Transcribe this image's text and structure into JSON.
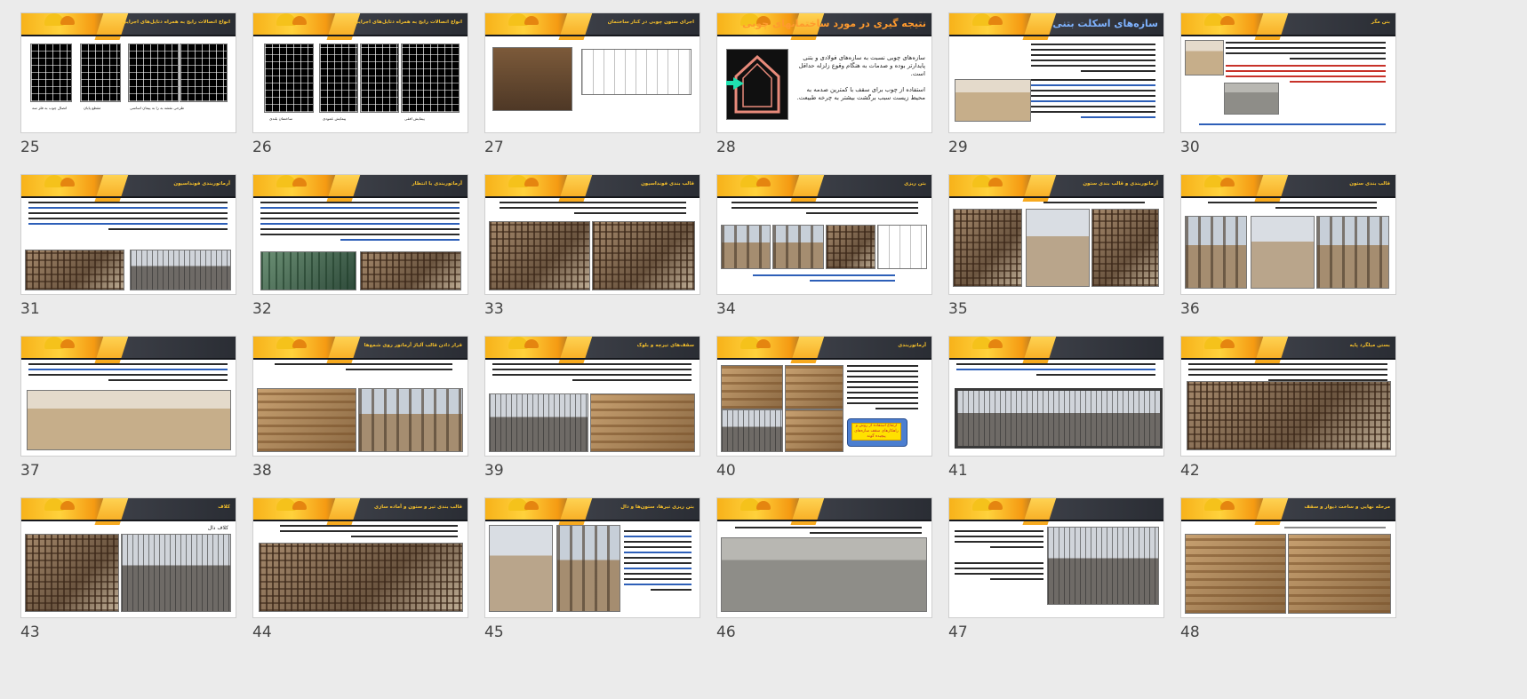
{
  "slides": [
    {
      "num": "25",
      "title": "انواع اتصالات رایج به همراه دتایل‌های اجرایی",
      "big": false,
      "layout": "diagrams4",
      "captions": [
        "اتصال چوب به فلز سه",
        "مقطع پایان",
        "طرحی نقشه به را به پیمان اساسی",
        ""
      ]
    },
    {
      "num": "26",
      "title": "انواع اتصالات رایج به همراه دتایل‌های اجرایی",
      "big": false,
      "layout": "diagrams3",
      "captions": [
        "ساختمان بلندی",
        "پیمایش عمودی",
        "پیمایش افقی"
      ]
    },
    {
      "num": "27",
      "title": "اجرای ستون چوبی در کنار ساختمان",
      "big": false,
      "layout": "photo-sketch",
      "captions": []
    },
    {
      "num": "28",
      "title": "نتیجه گیری در مورد ساختمانهای چوبی",
      "big": true,
      "layout": "house",
      "bullets": [
        "سازه‌های چوبی نسبت به سازه‌های فولادی و بتنی پایدارتر بوده و صدمات به هنگام وقوع زلزله حداقل است.",
        "استفاده از چوب برای سقف با کمترین صدمه به محیط زیست سبب برگشت بیشتر به چرخه طبیعت."
      ]
    },
    {
      "num": "29",
      "title": "سازه‌های اسکلت بتنی",
      "big": true,
      "layout": "text-photo-left",
      "captions": []
    },
    {
      "num": "30",
      "title": "بتن مگر",
      "big": false,
      "layout": "photo-right-text",
      "captions": []
    },
    {
      "num": "31",
      "title": "آرماتوربندی فونداسیون",
      "big": false,
      "layout": "text-2photos",
      "captions": []
    },
    {
      "num": "32",
      "title": "آرماتوربندی با انتظار",
      "big": false,
      "layout": "text-2photos-green",
      "captions": []
    },
    {
      "num": "33",
      "title": "قالب بندی فونداسیون",
      "big": false,
      "layout": "text-2photos-rebar",
      "captions": []
    },
    {
      "num": "34",
      "title": "بتن ریزی",
      "big": false,
      "layout": "text-4photos",
      "captions": []
    },
    {
      "num": "35",
      "title": "آرماتوربندی و قالب بندی ستون",
      "big": false,
      "layout": "text-3photos",
      "captions": []
    },
    {
      "num": "36",
      "title": "قالب بندی ستون",
      "big": false,
      "layout": "text-3photos-site",
      "captions": []
    },
    {
      "num": "37",
      "title": "",
      "big": false,
      "layout": "text-bigphoto",
      "captions": []
    },
    {
      "num": "38",
      "title": "قرار دادن قالب آلیاژ آرماتور روی شمع‌ها",
      "big": false,
      "layout": "text-2photos-wood",
      "captions": []
    },
    {
      "num": "39",
      "title": "سقف‌های تیرچه و بلوک",
      "big": false,
      "layout": "text-2photos-deck",
      "captions": []
    },
    {
      "num": "40",
      "title": "آرماتوربندی",
      "big": false,
      "layout": "photos-list",
      "box": "ارتفاع استفاده از روش و راهکارهای سقف سازه‌های پیچیده گونه"
    },
    {
      "num": "41",
      "title": "",
      "big": false,
      "layout": "text-framephoto",
      "captions": []
    },
    {
      "num": "42",
      "title": "بستن میلگرد پایه",
      "big": false,
      "layout": "text-bigphoto2",
      "captions": []
    },
    {
      "num": "43",
      "title": "کلاف",
      "big": false,
      "layout": "subtitle-2photos",
      "captions": [
        "کلاف دال"
      ]
    },
    {
      "num": "44",
      "title": "قالب بندی تیر و ستون و آماده سازی",
      "big": false,
      "layout": "text-bigphoto3",
      "captions": []
    },
    {
      "num": "45",
      "title": "بتن ریزی تیرها، ستون‌ها و دال",
      "big": false,
      "layout": "2photos-text",
      "captions": []
    },
    {
      "num": "46",
      "title": "",
      "big": false,
      "layout": "text-bigphoto4",
      "captions": []
    },
    {
      "num": "47",
      "title": "",
      "big": false,
      "layout": "text-left-photo-right",
      "captions": []
    },
    {
      "num": "48",
      "title": "مرحله نهایی و ساخت دیوار و سقف",
      "big": false,
      "layout": "text-2photos-brick",
      "captions": []
    }
  ]
}
